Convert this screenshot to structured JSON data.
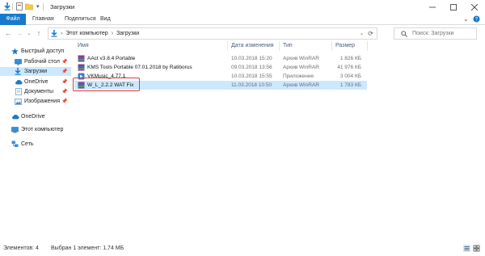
{
  "window": {
    "title": "Загрузки",
    "accent": "#1979ca"
  },
  "ribbon": {
    "tabs": [
      "Файл",
      "Главная",
      "Поделиться",
      "Вид"
    ]
  },
  "address": {
    "path": [
      "Этот компьютер",
      "Загрузки"
    ],
    "search_placeholder": "Поиск: Загрузки"
  },
  "nav": {
    "quick_access": "Быстрый доступ",
    "items": [
      {
        "label": "Рабочий стол",
        "pinned": true
      },
      {
        "label": "Загрузки",
        "pinned": true,
        "selected": true
      },
      {
        "label": "OneDrive",
        "pinned": true
      },
      {
        "label": "Документы",
        "pinned": true
      },
      {
        "label": "Изображения",
        "pinned": true
      }
    ],
    "onedrive": "OneDrive",
    "this_pc": "Этот компьютер",
    "network": "Сеть"
  },
  "columns": {
    "name": "Имя",
    "date": "Дата изменения",
    "type": "Тип",
    "size": "Размер"
  },
  "files": [
    {
      "name": "AAct v3.8.4 Portable",
      "date": "10.03.2018 15:20",
      "type": "Архив WinRAR",
      "size": "1 826 КБ"
    },
    {
      "name": "KMS Tools Portable 07.01.2018 by Ratiborus",
      "date": "09.03.2018 13:56",
      "type": "Архив WinRAR",
      "size": "41 976 КБ"
    },
    {
      "name": "VKMusic_4.77.1",
      "date": "10.03.2018 15:55",
      "type": "Приложение",
      "size": "3 004 КБ"
    },
    {
      "name": "W_L_2.2.2 WAT Fix",
      "date": "11.03.2018 10:50",
      "type": "Архив WinRAR",
      "size": "1 783 КБ",
      "selected": true
    }
  ],
  "status": {
    "count": "Элементов: 4",
    "selection": "Выбран 1 элемент: 1,74 МБ"
  }
}
